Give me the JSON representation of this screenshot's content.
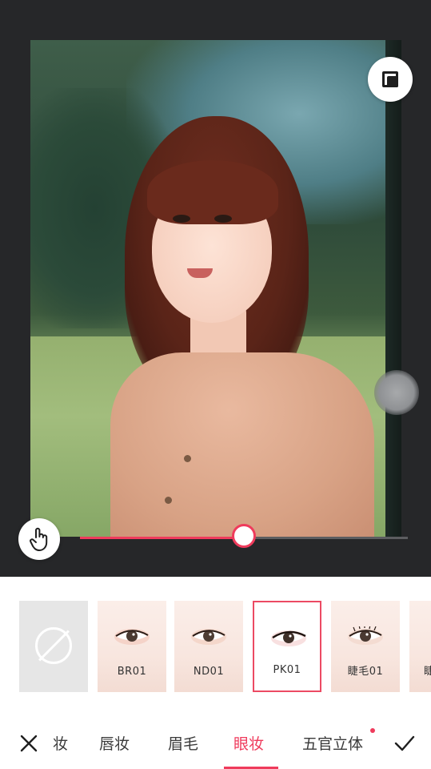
{
  "slider": {
    "value": 0.5
  },
  "presets": [
    {
      "id": "none",
      "label": ""
    },
    {
      "id": "br01",
      "label": "BR01"
    },
    {
      "id": "nd01",
      "label": "ND01"
    },
    {
      "id": "pk01",
      "label": "PK01",
      "selected": true
    },
    {
      "id": "lash01",
      "label": "睫毛01"
    },
    {
      "id": "partial",
      "label": "睫"
    }
  ],
  "tabs": [
    {
      "label": "妆"
    },
    {
      "label": "唇妆"
    },
    {
      "label": "眉毛"
    },
    {
      "label": "眼妆",
      "active": true
    },
    {
      "label": "五官立体",
      "badge": true
    }
  ],
  "colors": {
    "accent": "#ef3b5c"
  },
  "icons": {
    "compare": "compare-icon",
    "touch": "touch-hand-icon",
    "close": "close-icon",
    "confirm": "check-icon",
    "none": "no-effect-icon"
  }
}
